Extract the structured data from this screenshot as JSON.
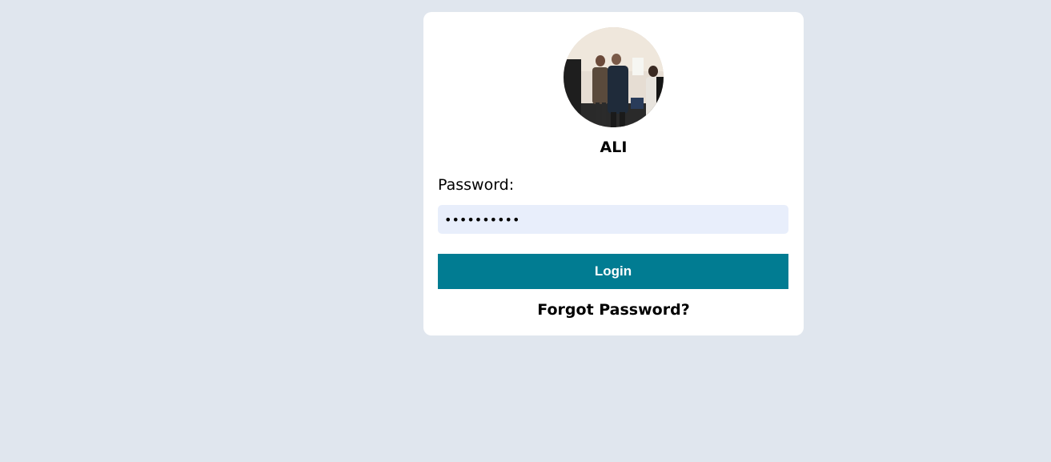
{
  "profile": {
    "avatar_alt": "user profile photo",
    "username": "ALI"
  },
  "form": {
    "password_label": "Password:",
    "password_value": "••••••••••",
    "login_label": "Login",
    "forgot_label": "Forgot Password?"
  },
  "colors": {
    "background": "#e0e6ee",
    "card": "#ffffff",
    "input_bg": "#e8eefb",
    "button": "#017c92"
  }
}
